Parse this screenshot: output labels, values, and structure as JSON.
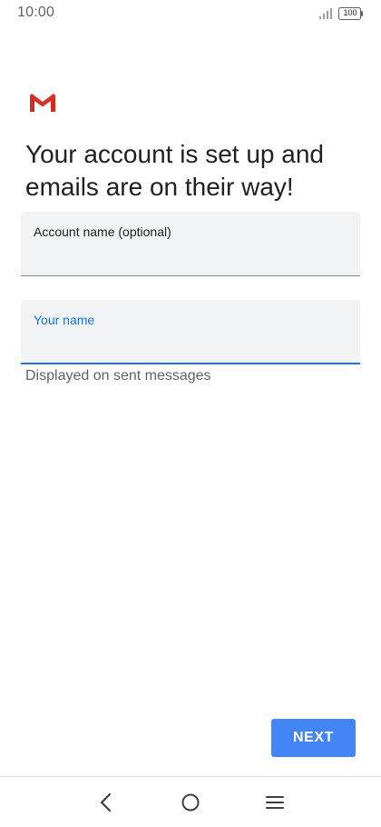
{
  "status_bar": {
    "time": "10:00",
    "battery_level": "100"
  },
  "icons": {
    "logo": "gmail-logo",
    "signal": "signal-icon",
    "battery": "battery-icon",
    "back": "back-icon",
    "home": "home-icon",
    "menu": "menu-icon"
  },
  "headline": "Your account is set up and emails are on their way!",
  "fields": {
    "account_name": {
      "label": "Account name (optional)",
      "value": ""
    },
    "your_name": {
      "label": "Your name",
      "value": "",
      "helper": "Displayed on sent messages"
    }
  },
  "actions": {
    "next_label": "NEXT"
  },
  "colors": {
    "accent": "#1a73e8",
    "button": "#4285f4",
    "gmail_red": "#d93025"
  }
}
